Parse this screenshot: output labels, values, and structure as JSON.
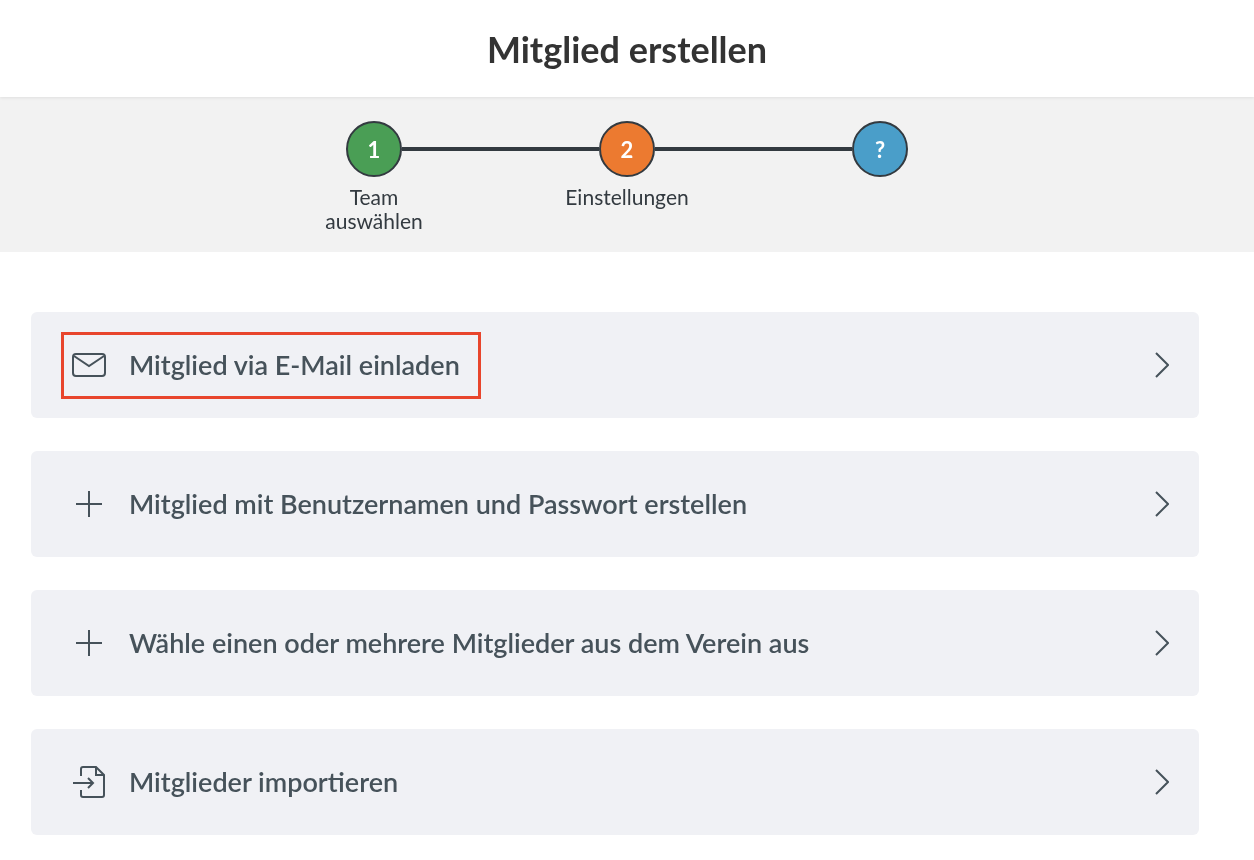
{
  "title": "Mitglied erstellen",
  "steps": [
    {
      "number": "1",
      "label": "Team auswählen",
      "color": "#4a9e55"
    },
    {
      "number": "2",
      "label": "Einstellungen",
      "color": "#ec7a30"
    },
    {
      "number": "?",
      "color": "#4a9ec9"
    }
  ],
  "options": [
    {
      "kind": "mail",
      "label": "Mitglied via E-Mail einladen",
      "highlighted": true
    },
    {
      "kind": "plus",
      "label": "Mitglied mit Benutzernamen und Passwort erstellen",
      "highlighted": false
    },
    {
      "kind": "plus",
      "label": "Wähle einen oder mehrere Mitglieder aus dem Verein aus",
      "highlighted": false
    },
    {
      "kind": "import",
      "label": "Mitglieder importieren",
      "highlighted": false
    }
  ]
}
